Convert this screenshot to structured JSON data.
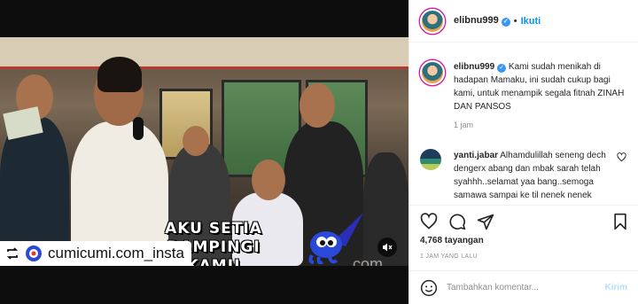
{
  "video": {
    "caption_line1": "AKU SETIA",
    "caption_line2": "DAMPINGI KAMU",
    "watermark": "com",
    "repost_handle": "cumicumi.com_insta"
  },
  "header": {
    "username": "elibnu999",
    "separator": "•",
    "follow_label": "Ikuti"
  },
  "caption": {
    "username": "elibnu999",
    "text": "Kami sudah menikah di hadapan Mamaku, ini sudah cukup bagi kami, untuk menampik segala fitnah ZINAH DAN PANSOS",
    "time": "1 jam"
  },
  "comment": {
    "username": "yanti.jabar",
    "text": "Alhamdulillah seneng dech dengerx abang dan mbak sarah telah syahhh..selamat yaa bang..semoga samawa sampai ke til nenek nenek nini"
  },
  "stats": {
    "views": "4,768 tayangan",
    "post_time": "1 JAM YANG LALU"
  },
  "comment_bar": {
    "placeholder": "Tambahkan komentar...",
    "send_label": "Kirim"
  },
  "colors": {
    "link": "#0095f6",
    "verified": "#3897f0",
    "send_disabled": "#b2dffc",
    "muted_text": "#8e8e8e"
  },
  "icons": [
    "verified-badge-icon",
    "heart-icon",
    "comment-icon",
    "share-icon",
    "save-icon",
    "emoji-icon",
    "mute-icon",
    "repost-icon"
  ]
}
